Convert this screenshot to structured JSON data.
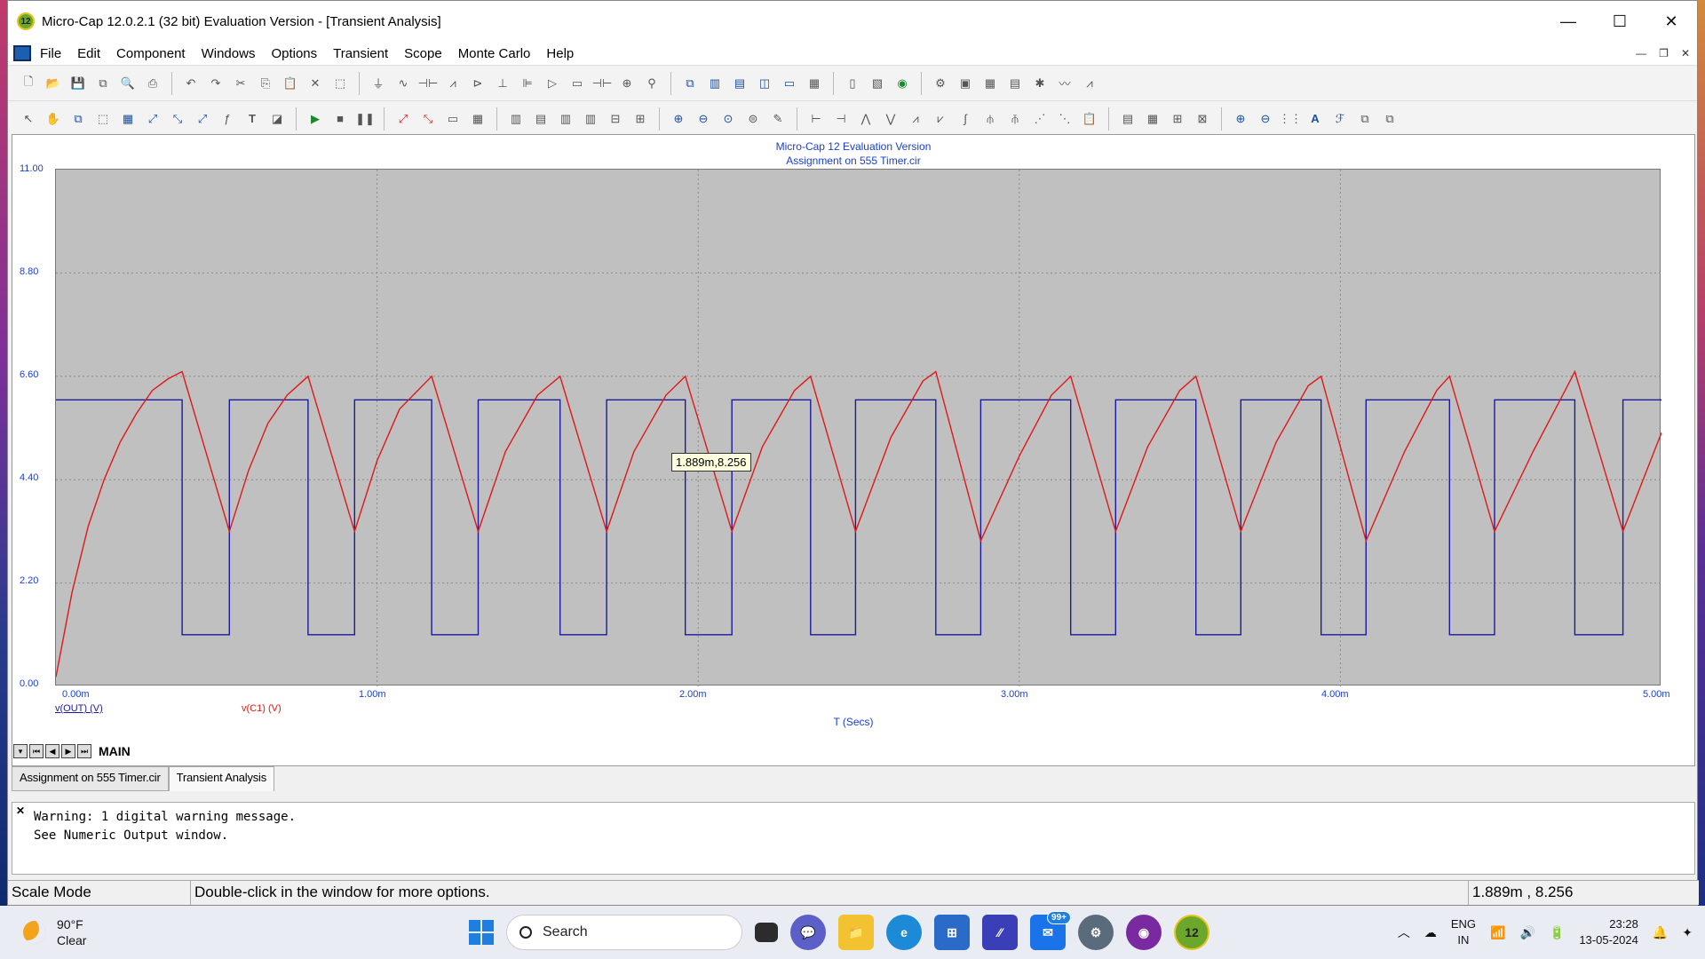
{
  "window": {
    "title": "Micro-Cap 12.0.2.1 (32 bit) Evaluation Version - [Transient Analysis]",
    "app_icon_text": "12",
    "minimize": "—",
    "maximize": "☐",
    "close": "✕"
  },
  "menu": [
    "File",
    "Edit",
    "Component",
    "Windows",
    "Options",
    "Transient",
    "Scope",
    "Monte Carlo",
    "Help"
  ],
  "plot": {
    "title_line1": "Micro-Cap 12 Evaluation Version",
    "title_line2": "Assignment on  555 Timer.cir",
    "tooltip": "1.889m,8.256",
    "x_axis_title": "T (Secs)",
    "legend": [
      "v(OUT) (V)",
      "v(C1) (V)"
    ],
    "colors": {
      "v_out": "#1a1aa0",
      "v_c1": "#e01818",
      "axis_text": "#1a3fd0",
      "plot_bg": "#c0c0c0"
    }
  },
  "chart_data": {
    "type": "line",
    "xlabel": "T (Secs)",
    "x_unit": "ms",
    "xlim": [
      0,
      5
    ],
    "ylim": [
      0,
      11
    ],
    "x_ticks": [
      "0.00m",
      "1.00m",
      "2.00m",
      "3.00m",
      "4.00m",
      "5.00m"
    ],
    "y_ticks": [
      "0.00",
      "2.20",
      "4.40",
      "6.60",
      "8.80",
      "11.00"
    ],
    "grid": true,
    "legend_placement": "bottom-left",
    "series": [
      {
        "name": "v(OUT) (V)",
        "color": "#1a1aa0",
        "x": [
          0,
          0.393,
          0.393,
          0.54,
          0.54,
          0.785,
          0.785,
          0.93,
          0.93,
          1.17,
          1.17,
          1.315,
          1.315,
          1.57,
          1.57,
          1.715,
          1.715,
          1.96,
          1.96,
          2.105,
          2.105,
          2.35,
          2.35,
          2.49,
          2.49,
          2.74,
          2.74,
          2.88,
          2.88,
          3.16,
          3.16,
          3.3,
          3.3,
          3.55,
          3.55,
          3.69,
          3.69,
          3.94,
          3.94,
          4.08,
          4.08,
          4.34,
          4.34,
          4.48,
          4.48,
          4.73,
          4.73,
          4.88,
          4.88,
          5.0
        ],
        "y": [
          6.1,
          6.1,
          1.1,
          1.1,
          6.1,
          6.1,
          1.1,
          1.1,
          6.1,
          6.1,
          1.1,
          1.1,
          6.1,
          6.1,
          1.1,
          1.1,
          6.1,
          6.1,
          1.1,
          1.1,
          6.1,
          6.1,
          1.1,
          1.1,
          6.1,
          6.1,
          1.1,
          1.1,
          6.1,
          6.1,
          1.1,
          1.1,
          6.1,
          6.1,
          1.1,
          1.1,
          6.1,
          6.1,
          1.1,
          1.1,
          6.1,
          6.1,
          1.1,
          1.1,
          6.1,
          6.1,
          1.1,
          1.1,
          6.1,
          6.1
        ]
      },
      {
        "name": "v(C1) (V)",
        "color": "#e01818",
        "x": [
          0,
          0.05,
          0.1,
          0.15,
          0.2,
          0.25,
          0.3,
          0.35,
          0.393,
          0.54,
          0.6,
          0.66,
          0.72,
          0.785,
          0.93,
          1.0,
          1.07,
          1.17,
          1.315,
          1.4,
          1.5,
          1.57,
          1.715,
          1.8,
          1.9,
          1.96,
          2.105,
          2.2,
          2.3,
          2.35,
          2.49,
          2.6,
          2.7,
          2.74,
          2.88,
          3.0,
          3.1,
          3.16,
          3.3,
          3.4,
          3.5,
          3.55,
          3.69,
          3.8,
          3.9,
          3.94,
          4.08,
          4.2,
          4.3,
          4.34,
          4.48,
          4.6,
          4.7,
          4.73,
          4.88,
          5.0
        ],
        "y": [
          0.2,
          2.0,
          3.4,
          4.4,
          5.2,
          5.8,
          6.3,
          6.55,
          6.7,
          3.3,
          4.6,
          5.6,
          6.2,
          6.6,
          3.3,
          4.8,
          5.9,
          6.6,
          3.3,
          5.0,
          6.2,
          6.6,
          3.3,
          5.0,
          6.2,
          6.6,
          3.3,
          5.1,
          6.3,
          6.6,
          3.3,
          5.3,
          6.5,
          6.7,
          3.1,
          4.9,
          6.2,
          6.6,
          3.3,
          5.1,
          6.3,
          6.6,
          3.3,
          5.2,
          6.4,
          6.6,
          3.1,
          5.0,
          6.3,
          6.6,
          3.3,
          5.0,
          6.3,
          6.7,
          3.3,
          5.4
        ]
      }
    ]
  },
  "sheet": {
    "tab": "MAIN"
  },
  "doc_tabs": [
    "Assignment on  555 Timer.cir",
    "Transient Analysis"
  ],
  "messages": {
    "text": "Warning: 1 digital warning message.\nSee Numeric Output window."
  },
  "status": {
    "mode": "Scale Mode",
    "hint": "Double-click in the window for more options.",
    "coords": "1.889m , 8.256"
  },
  "taskbar": {
    "temp": "90°F",
    "weather": "Clear",
    "search_placeholder": "Search",
    "mail_badge": "99+",
    "lang1": "ENG",
    "lang2": "IN",
    "time": "23:28",
    "date": "13-05-2024",
    "microcap_icon": "12"
  }
}
